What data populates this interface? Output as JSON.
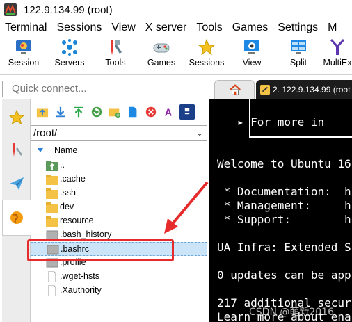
{
  "window": {
    "title": "122.9.134.99 (root)"
  },
  "menu": [
    "Terminal",
    "Sessions",
    "View",
    "X server",
    "Tools",
    "Games",
    "Settings",
    "M"
  ],
  "toolbar": [
    "Session",
    "Servers",
    "Tools",
    "Games",
    "Sessions",
    "View",
    "Split",
    "MultiEx"
  ],
  "quick_connect": {
    "placeholder": "Quick connect..."
  },
  "tabs": {
    "session_label": "2. 122.9.134.99 (root"
  },
  "sftp": {
    "path": "/root/",
    "column_name": "Name",
    "files": [
      {
        "name": "..",
        "type": "up",
        "icon": "folder-up-icon"
      },
      {
        "name": ".cache",
        "type": "folder",
        "icon": "folder-icon"
      },
      {
        "name": ".ssh",
        "type": "folder",
        "icon": "folder-icon"
      },
      {
        "name": "dev",
        "type": "folder",
        "icon": "folder-icon"
      },
      {
        "name": "resource",
        "type": "folder",
        "icon": "folder-icon"
      },
      {
        "name": ".bash_history",
        "type": "file",
        "icon": "file-gray-icon"
      },
      {
        "name": ".bashrc",
        "type": "file",
        "icon": "file-gray-icon",
        "selected": true
      },
      {
        "name": ".profile",
        "type": "file",
        "icon": "file-gray-icon"
      },
      {
        "name": ".wget-hsts",
        "type": "file",
        "icon": "file-white-icon"
      },
      {
        "name": ".Xauthority",
        "type": "file",
        "icon": "file-white-icon"
      }
    ]
  },
  "terminal": {
    "lines": [
      "   ▸ For more in",
      "",
      "Welcome to Ubuntu 16",
      "",
      " * Documentation:  h",
      " * Management:     h",
      " * Support:        h",
      "",
      "UA Infra: Extended S",
      "",
      "0 updates can be app",
      "",
      "217 additional secur",
      "Learn more about ena"
    ]
  },
  "watermark": "CSDN @萌新2016",
  "colors": {
    "accent": "#2b7fd6",
    "folder": "#f4c245",
    "highlight_red": "#e52b2b",
    "selection": "#cce4f7"
  }
}
